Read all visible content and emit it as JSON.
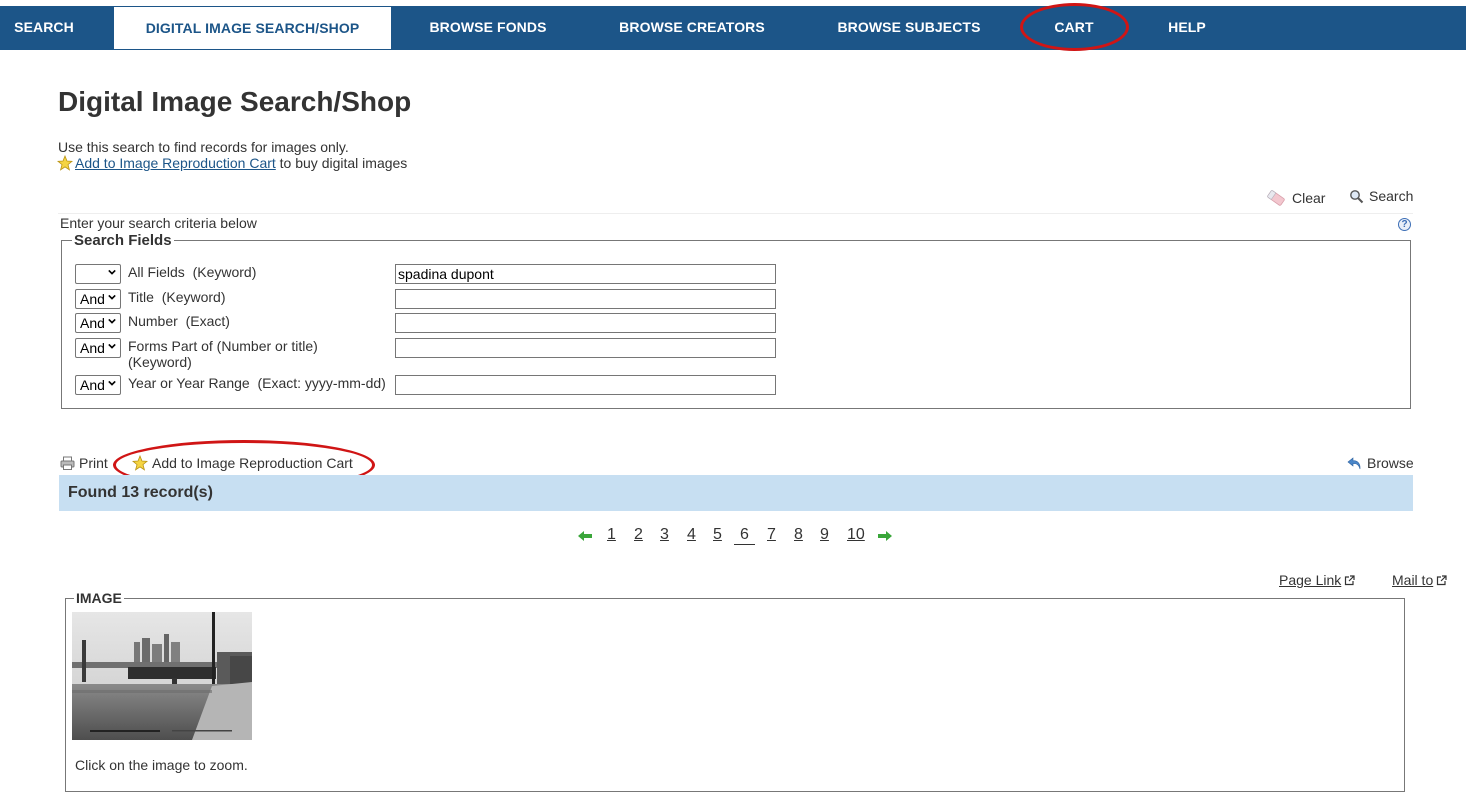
{
  "nav": {
    "items": [
      {
        "label": "SEARCH"
      },
      {
        "label": "DIGITAL IMAGE SEARCH/SHOP"
      },
      {
        "label": "BROWSE FONDS"
      },
      {
        "label": "BROWSE CREATORS"
      },
      {
        "label": "BROWSE SUBJECTS"
      },
      {
        "label": "CART"
      },
      {
        "label": "HELP"
      }
    ],
    "active_index": 1
  },
  "page": {
    "title": "Digital Image Search/Shop",
    "intro_line1": "Use this search to find records for images only.",
    "intro_link": "Add to Image Reproduction Cart",
    "intro_line2_suffix": " to buy digital images"
  },
  "toolbar": {
    "clear_label": "Clear",
    "search_label": "Search"
  },
  "criteria": {
    "instruction": "Enter your search criteria below",
    "legend": "Search Fields",
    "fields": [
      {
        "operator": "",
        "label": "All Fields  (Keyword)",
        "value": "spadina dupont"
      },
      {
        "operator": "And",
        "label": "Title  (Keyword)",
        "value": ""
      },
      {
        "operator": "And",
        "label": "Number  (Exact)",
        "value": ""
      },
      {
        "operator": "And",
        "label": "Forms Part of (Number or title) (Keyword)",
        "value": ""
      },
      {
        "operator": "And",
        "label": "Year or Year Range  (Exact: yyyy-mm-dd)",
        "value": ""
      }
    ]
  },
  "results": {
    "print_label": "Print",
    "add_cart_label": "Add to Image Reproduction Cart",
    "browse_label": "Browse",
    "found_text": "Found 13 record(s)"
  },
  "pager": {
    "pages": [
      "1",
      "2",
      "3",
      "4",
      "5",
      "6",
      "7",
      "8",
      "9",
      "10"
    ],
    "current": "6"
  },
  "record": {
    "page_link_label": "Page Link",
    "mail_to_label": "Mail to",
    "image_legend": "IMAGE",
    "zoom_note": "Click on the image to zoom."
  },
  "colors": {
    "nav_bg": "#1c5588",
    "result_bar": "#c7dff2",
    "highlight_ellipse": "#d01515",
    "arrow_green": "#3aa63a"
  }
}
